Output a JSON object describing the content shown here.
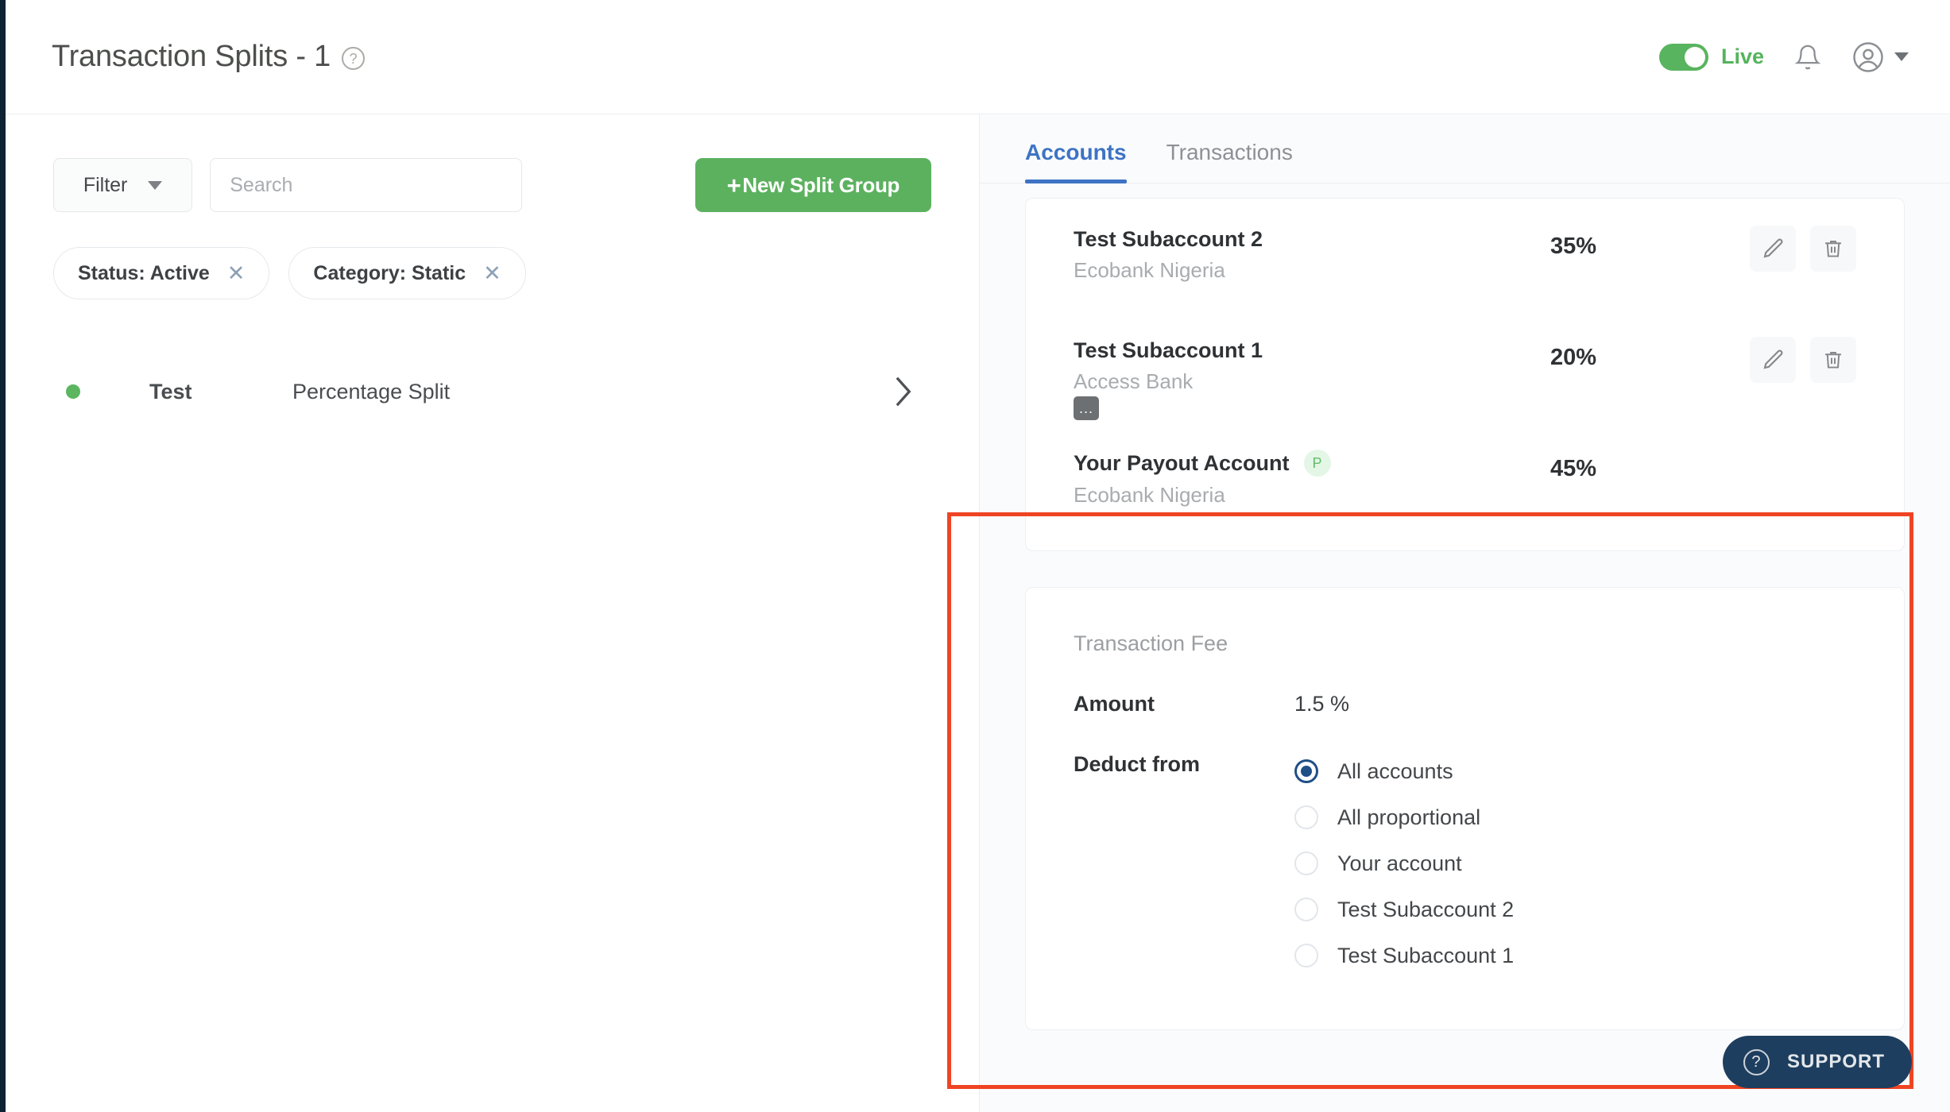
{
  "header": {
    "title": "Transaction Splits - 1",
    "help_icon": "question-circle-icon",
    "mode_label": "Live",
    "mode_on": true,
    "bell_icon": "bell-icon",
    "avatar_icon": "user-circle-icon",
    "caret_icon": "chevron-down-icon"
  },
  "left_pane": {
    "filter": {
      "label": "Filter",
      "caret_icon": "chevron-down-icon"
    },
    "search": {
      "value": "",
      "placeholder": "Search",
      "icon": "search-input"
    },
    "new_split_button": {
      "plus": "+",
      "label": "New Split Group"
    },
    "chips": [
      {
        "label": "Status: Active",
        "remove_icon": "close-icon"
      },
      {
        "label": "Category: Static",
        "remove_icon": "close-icon"
      }
    ],
    "splits": [
      {
        "status": "active",
        "status_color": "#5cb65f",
        "name": "Test",
        "type": "Percentage Split",
        "chevron_icon": "chevron-right-icon"
      }
    ]
  },
  "right_pane": {
    "tabs": [
      {
        "label": "Accounts",
        "active": true
      },
      {
        "label": "Transactions",
        "active": false
      }
    ],
    "accounts": [
      {
        "name": "Test Subaccount 2",
        "bank": "Ecobank Nigeria",
        "percent": "35%",
        "badge": "",
        "tooltip": "",
        "edit_icon": "pencil-icon",
        "delete_icon": "trash-icon"
      },
      {
        "name": "Test Subaccount 1",
        "bank": "Access Bank",
        "percent": "20%",
        "badge": "",
        "tooltip": "...",
        "edit_icon": "pencil-icon",
        "delete_icon": "trash-icon"
      },
      {
        "name": "Your Payout Account",
        "bank": "Ecobank Nigeria",
        "percent": "45%",
        "badge": "P",
        "tooltip": "",
        "edit_icon": "",
        "delete_icon": ""
      }
    ],
    "transaction_fee": {
      "heading": "Transaction Fee",
      "amount_label": "Amount",
      "amount_value": "1.5 %",
      "deduct_label": "Deduct from",
      "deduct_options": [
        {
          "label": "All accounts",
          "selected": true
        },
        {
          "label": "All proportional",
          "selected": false
        },
        {
          "label": "Your account",
          "selected": false
        },
        {
          "label": "Test Subaccount 2",
          "selected": false
        },
        {
          "label": "Test Subaccount 1",
          "selected": false
        }
      ]
    }
  },
  "support": {
    "label": "SUPPORT",
    "icon": "question-circle-icon"
  },
  "annotation": {
    "highlight_color": "#ef4423"
  },
  "colors": {
    "brand_green": "#5cb15f",
    "tab_blue": "#3d73c4",
    "radio_blue": "#1f4f87",
    "support_navy": "#1e3e5f",
    "rail_navy": "#0e2233"
  }
}
